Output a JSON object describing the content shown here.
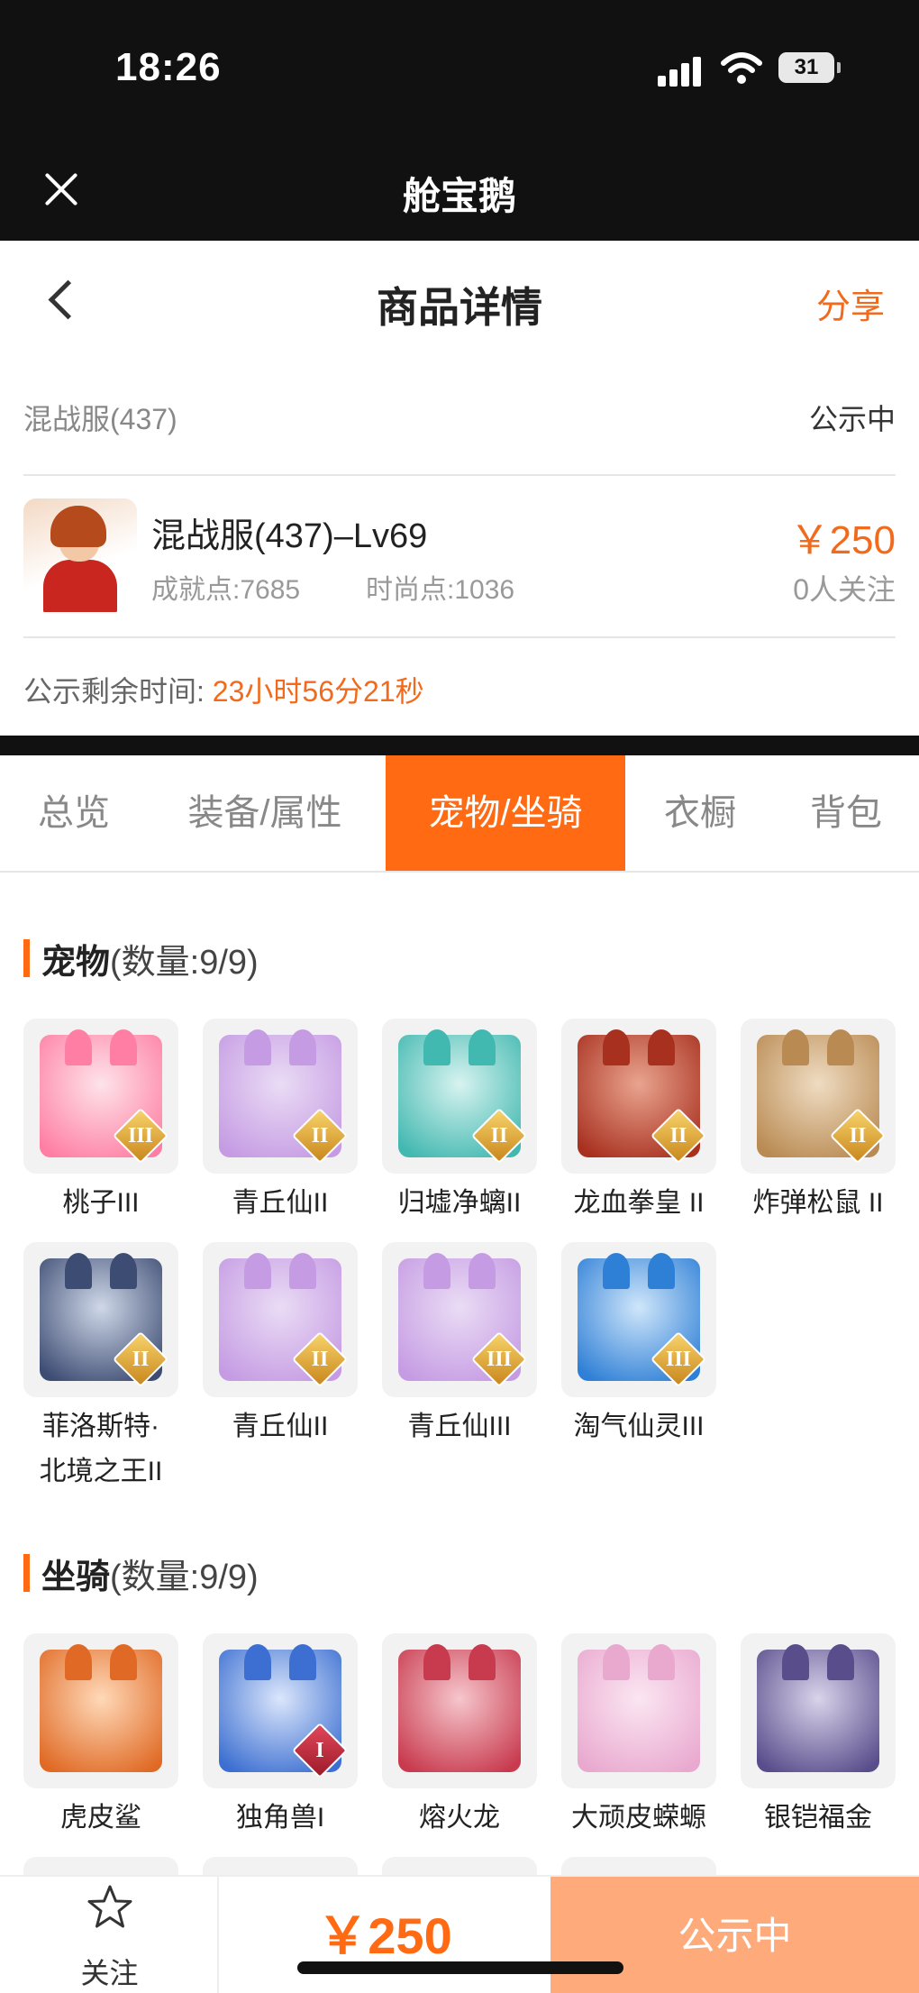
{
  "status_bar": {
    "time": "18:26",
    "battery": "31"
  },
  "app_bar": {
    "title": "舱宝鹅"
  },
  "page_header": {
    "title": "商品详情",
    "share_label": "分享"
  },
  "listing": {
    "server": "混战服(437)",
    "status": "公示中",
    "name": "混战服(437)–Lv69",
    "achievement": "成就点:7685",
    "fashion": "时尚点:1036",
    "price": "￥250",
    "followers": "0人关注",
    "countdown_label": "公示剩余时间:",
    "countdown_value": "23小时56分21秒"
  },
  "tabs": [
    {
      "label": "总览"
    },
    {
      "label": "装备/属性"
    },
    {
      "label": "宠物/坐骑"
    },
    {
      "label": "衣橱"
    },
    {
      "label": "背包"
    }
  ],
  "active_tab": "宠物/坐骑",
  "pets": {
    "title": "宠物",
    "count": "(数量:9/9)",
    "items": [
      {
        "name": "桃子III",
        "tier": "III",
        "colors": [
          "#fde3ea",
          "#ff7ea3"
        ]
      },
      {
        "name": "青丘仙II",
        "tier": "II",
        "colors": [
          "#eadcf5",
          "#c59be3"
        ]
      },
      {
        "name": "归墟净螭II",
        "tier": "II",
        "colors": [
          "#d8f3f0",
          "#41b8b0"
        ]
      },
      {
        "name": "龙血拳皇 II",
        "tier": "II",
        "colors": [
          "#e9a48f",
          "#a8301f"
        ]
      },
      {
        "name": "炸弹松鼠 II",
        "tier": "II",
        "colors": [
          "#efdcc2",
          "#b98a52"
        ]
      },
      {
        "name": "菲洛斯特·北境之王II",
        "tier": "II",
        "colors": [
          "#cfd8e8",
          "#3d4c73"
        ]
      },
      {
        "name": "青丘仙II",
        "tier": "II",
        "colors": [
          "#eadcf5",
          "#c59be3"
        ]
      },
      {
        "name": "青丘仙III",
        "tier": "III",
        "colors": [
          "#eadcf5",
          "#c59be3"
        ]
      },
      {
        "name": "淘气仙灵III",
        "tier": "III",
        "colors": [
          "#cfe6fa",
          "#2e7fd6"
        ]
      }
    ]
  },
  "mounts": {
    "title": "坐骑",
    "count": "(数量:9/9)",
    "items": [
      {
        "name": "虎皮鲨",
        "tier": "",
        "colors": [
          "#ffd9b8",
          "#e06a25"
        ]
      },
      {
        "name": "独角兽I",
        "tier": "I",
        "colors": [
          "#dbe6fb",
          "#3c6fd1"
        ]
      },
      {
        "name": "熔火龙",
        "tier": "",
        "colors": [
          "#f6c6cc",
          "#c83a4e"
        ]
      },
      {
        "name": "大顽皮蝾螈",
        "tier": "",
        "colors": [
          "#fbe6f2",
          "#e9a9cf"
        ]
      },
      {
        "name": "银铠福金",
        "tier": "",
        "colors": [
          "#d9d3ea",
          "#5a4d8c"
        ]
      }
    ]
  },
  "bottom_bar": {
    "follow_label": "关注",
    "price": "￥250",
    "status_label": "公示中"
  },
  "theme": {
    "accent": "#ff6a13",
    "dark": "#111111"
  }
}
